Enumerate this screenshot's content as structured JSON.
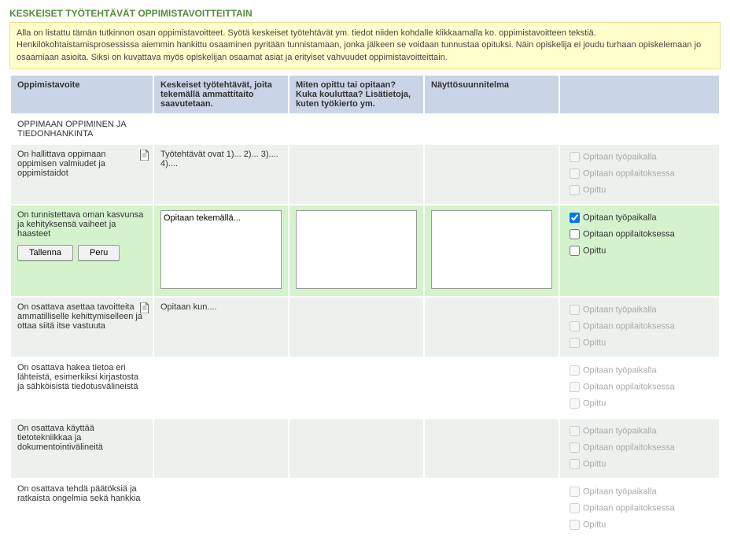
{
  "section_title": "KESKEISET TYÖTEHTÄVÄT OPPIMISTAVOITTEITTAIN",
  "intro_text": "Alla on listattu tämän tutkinnon osan oppimistavoitteet. Syötä keskeiset työtehtävät ym. tiedot niiden kohdalle klikkaamalla ko. oppimistavoitteen tekstiä. Henkilökohtaistamisprosessissa aiemmin hankittu osaaminen pyritään tunnistamaan, jonka jälkeen se voidaan tunnustaa opituksi. Näin opiskelija ei joudu turhaan opiskelemaan jo osaamiaan asioita. Siksi on kuvattava myös opiskelijan osaamat asiat ja erityiset vahvuudet oppimistavoitteittain.",
  "headers": {
    "goal": "Oppimistavoite",
    "tasks": "Keskeiset työtehtävät, joita tekemällä ammattitaito saavutetaan.",
    "how": "Miten opittu tai opitaan? Kuka kouluttaa? Lisätietoja, kuten työkierto ym.",
    "demo": "Näyttösuunnitelma"
  },
  "section_row": "OPPIMAAN OPPIMINEN JA TIEDONHANKINTA",
  "checkbox_labels": {
    "workplace": "Opitaan työpaikalla",
    "institution": "Opitaan oppilaitoksessa",
    "learned": "Opittu"
  },
  "buttons": {
    "save": "Tallenna",
    "cancel": "Peru"
  },
  "active_row": {
    "goal": "On tunnistettava oman kasvunsa ja kehityksensä vaiheet ja haasteet",
    "tasks_value": "Opitaan tekemällä...",
    "how_value": "",
    "demo_value": "",
    "chk_workplace": true,
    "chk_institution": false,
    "chk_learned": false
  },
  "rows": [
    {
      "goal": "On hallittava oppimaan oppimisen valmiudet ja oppimistaidot",
      "has_doc": true,
      "tasks": "Työtehtävät ovat 1)... 2)... 3).... 4)....",
      "alt": true
    },
    {
      "goal": "On osattava asettaa tavoitteita ammatilliselle kehittymiselleen ja ottaa siitä itse vastuuta",
      "has_doc": true,
      "tasks": "Opitaan kun....",
      "alt": true
    },
    {
      "goal": "On osattava hakea tietoa eri lähteistä, esimerkiksi kirjastosta ja sähköisistä tiedotusvälineistä",
      "has_doc": false,
      "tasks": "",
      "alt": false
    },
    {
      "goal": "On osattava käyttää tietotekniikkaa ja dokumentointivälineitä",
      "has_doc": false,
      "tasks": "",
      "alt": true
    },
    {
      "goal": "On osattava tehdä päätöksiä ja ratkaista ongelmia sekä hankkia",
      "has_doc": false,
      "tasks": "",
      "alt": false
    }
  ]
}
